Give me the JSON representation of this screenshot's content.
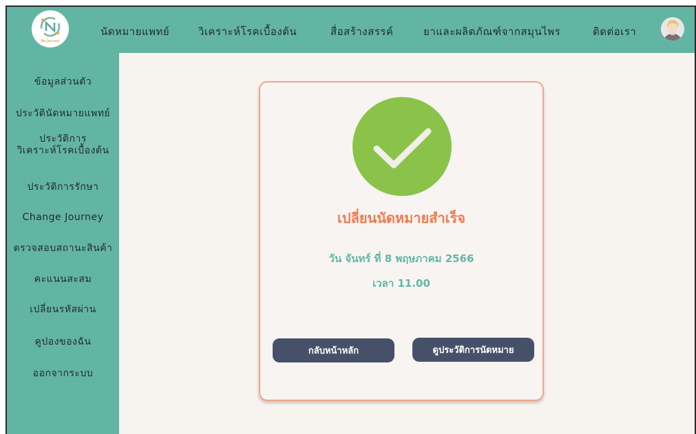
{
  "nav": {
    "logo_text": "Re Jouney",
    "items": [
      {
        "label": "นัดหมายแพทย์"
      },
      {
        "label": "วิเคราะห์โรคเบื้องต้น"
      },
      {
        "label": "สื่อสร้างสรรค์"
      },
      {
        "label": "ยาและผลิตภัณฑ์จากสมุนไพร"
      },
      {
        "label": "ติดต่อเรา"
      }
    ]
  },
  "sidebar": {
    "items": [
      {
        "label": "ข้อมูลส่วนตัว"
      },
      {
        "label": "ประวัตินัดหมายแพทย์"
      },
      {
        "label": "ประวัติการ"
      },
      {
        "label": "วิเคราะห์โรคเบื้องต้น"
      },
      {
        "label": "ประวัติการรักษา"
      },
      {
        "label": "Change Journey"
      },
      {
        "label": "ตรวจสอบสถานะสินค้า"
      },
      {
        "label": "คะแนนสะสม"
      },
      {
        "label": "เปลี่ยนรหัสผ่าน"
      },
      {
        "label": "คูปองของฉัน"
      },
      {
        "label": "ออกจากระบบ"
      }
    ]
  },
  "confirmation": {
    "title": "เปลี่ยนนัดหมายสำเร็จ",
    "date": "วัน จันทร์ ที่ 8 พฤษภาคม 2566",
    "time": "เวลา 11.00",
    "back_button": "กลับหน้าหลัก",
    "history_button": "ดูประวัติการนัดหมาย"
  },
  "colors": {
    "accent_teal": "#63b5a3",
    "success_green": "#8bc34a",
    "title_orange": "#f07b4e",
    "button_navy": "#465169"
  },
  "icons": {
    "check": "check-circle-icon",
    "avatar": "user-avatar"
  }
}
